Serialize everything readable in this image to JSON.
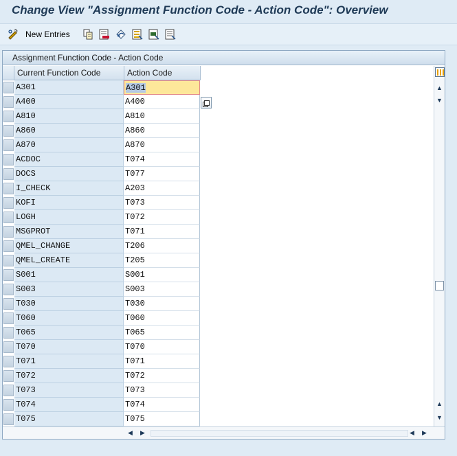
{
  "window": {
    "title": "Change View \"Assignment Function Code - Action Code\": Overview"
  },
  "toolbar": {
    "new_entries_label": "New Entries",
    "icons": [
      "change-display-icon",
      "copy-icon",
      "delete-icon",
      "undo-icon",
      "select-all-icon",
      "select-block-icon",
      "deselect-all-icon"
    ]
  },
  "table": {
    "title": "Assignment Function Code - Action Code",
    "columns": [
      "Current Function Code",
      "Action Code"
    ],
    "rows": [
      [
        "A301",
        "A301"
      ],
      [
        "A400",
        "A400"
      ],
      [
        "A810",
        "A810"
      ],
      [
        "A860",
        "A860"
      ],
      [
        "A870",
        "A870"
      ],
      [
        "ACDOC",
        "T074"
      ],
      [
        "DOCS",
        "T077"
      ],
      [
        "I_CHECK",
        "A203"
      ],
      [
        "KOFI",
        "T073"
      ],
      [
        "LOGH",
        "T072"
      ],
      [
        "MSGPROT",
        "T071"
      ],
      [
        "QMEL_CHANGE",
        "T206"
      ],
      [
        "QMEL_CREATE",
        "T205"
      ],
      [
        "S001",
        "S001"
      ],
      [
        "S003",
        "S003"
      ],
      [
        "T030",
        "T030"
      ],
      [
        "T060",
        "T060"
      ],
      [
        "T065",
        "T065"
      ],
      [
        "T070",
        "T070"
      ],
      [
        "T071",
        "T071"
      ],
      [
        "T072",
        "T072"
      ],
      [
        "T073",
        "T073"
      ],
      [
        "T074",
        "T074"
      ],
      [
        "T075",
        "T075"
      ]
    ],
    "active_row": 0
  },
  "colors": {
    "key_bg": "#dce9f4",
    "active_cell": "#fde79a",
    "title": "#1f3a56"
  }
}
